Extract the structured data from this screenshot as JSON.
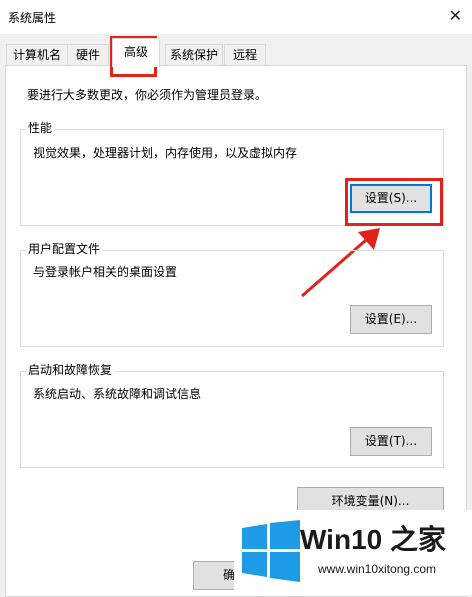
{
  "window": {
    "title": "系统属性"
  },
  "tabs": [
    {
      "label": "计算机名"
    },
    {
      "label": "硬件"
    },
    {
      "label": "高级"
    },
    {
      "label": "系统保护"
    },
    {
      "label": "远程"
    }
  ],
  "notice": "要进行大多数更改，你必须作为管理员登录。",
  "performance": {
    "legend": "性能",
    "description": "视觉效果，处理器计划，内存使用，以及虚拟内存",
    "button": "设置(S)..."
  },
  "user_profiles": {
    "legend": "用户配置文件",
    "description": "与登录帐户相关的桌面设置",
    "button": "设置(E)..."
  },
  "startup_recovery": {
    "legend": "启动和故障恢复",
    "description": "系统启动、系统故障和调试信息",
    "button": "设置(T)..."
  },
  "env_button": "环境变量(N)...",
  "ok_button_partial": "确",
  "watermark": {
    "brand": "Win10 之家",
    "url": "www.win10xitong.com"
  },
  "colors": {
    "annotation_red": "#e2231a",
    "focus_blue": "#0078d7",
    "logo_blue": "#1e9be6"
  }
}
